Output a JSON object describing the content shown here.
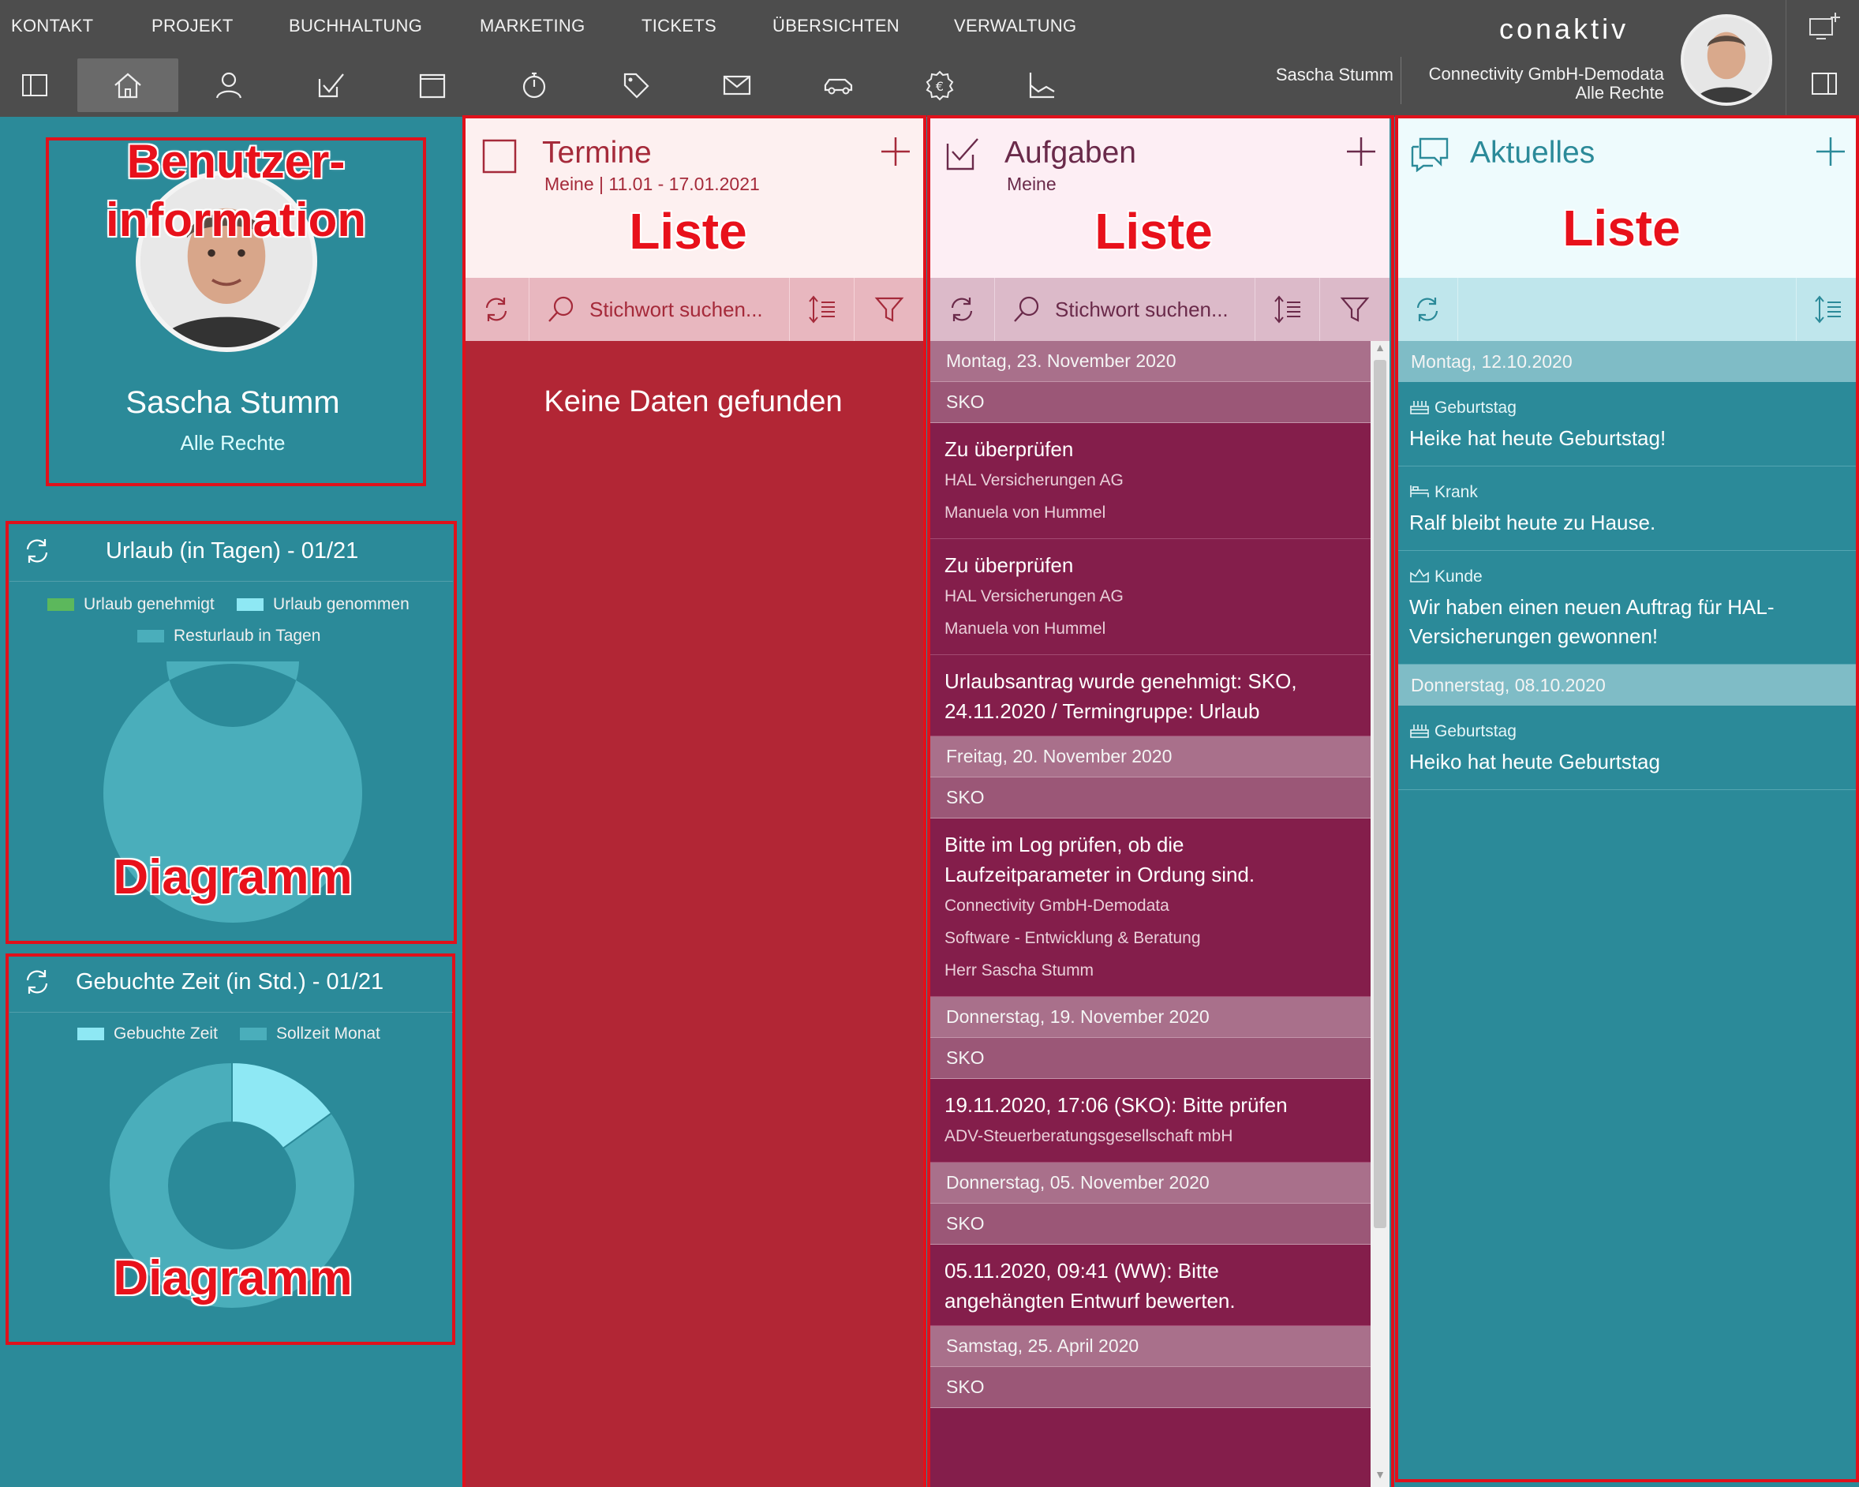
{
  "nav": {
    "menu": [
      "KONTAKT",
      "PROJEKT",
      "BUCHHALTUNG",
      "MARKETING",
      "TICKETS",
      "ÜBERSICHTEN",
      "VERWALTUNG"
    ],
    "icons": [
      "sidebar-left-icon",
      "home-icon",
      "contact-icon",
      "task-icon",
      "calendar-icon",
      "stopwatch-icon",
      "tag-icon",
      "mail-icon",
      "car-icon",
      "euro-icon",
      "chart-icon"
    ],
    "brand": "conaktiv",
    "user_name": "Sascha Stumm",
    "company": "Connectivity GmbH-Demodata",
    "rights": "Alle Rechte"
  },
  "profile": {
    "annotation": "Benutzer-information",
    "name": "Sascha Stumm",
    "role": "Alle Rechte"
  },
  "widgets": {
    "annotation": "Diagramm",
    "vacation": {
      "title": "Urlaub (in Tagen) - 01/21",
      "legend": [
        "Urlaub genehmigt",
        "Urlaub genommen",
        "Resturlaub in Tagen"
      ],
      "colors": [
        "#5cb85c",
        "#8ee8f4",
        "#4aaebb"
      ]
    },
    "time": {
      "title": "Gebuchte Zeit (in Std.) - 01/21",
      "legend": [
        "Gebuchte Zeit",
        "Sollzeit Monat"
      ],
      "colors": [
        "#8ee8f4",
        "#4aaebb"
      ]
    }
  },
  "chart_data": [
    {
      "type": "pie",
      "title": "Urlaub (in Tagen) - 01/21",
      "categories": [
        "Urlaub genehmigt",
        "Urlaub genommen",
        "Resturlaub in Tagen"
      ],
      "values": [
        0,
        0,
        1
      ]
    },
    {
      "type": "pie",
      "title": "Gebuchte Zeit (in Std.) - 01/21",
      "categories": [
        "Gebuchte Zeit",
        "Sollzeit Monat"
      ],
      "values": [
        0.15,
        0.85
      ]
    }
  ],
  "termine": {
    "title": "Termine",
    "subtitle": "Meine | 11.01 - 17.01.2021",
    "annotation": "Liste",
    "search_placeholder": "Stichwort suchen...",
    "empty": "Keine Daten gefunden"
  },
  "aufgaben": {
    "title": "Aufgaben",
    "subtitle": "Meine",
    "annotation": "Liste",
    "search_placeholder": "Stichwort suchen...",
    "rows": [
      {
        "kind": "date",
        "text": "Montag, 23. November 2020"
      },
      {
        "kind": "user",
        "text": "SKO"
      },
      {
        "kind": "item",
        "title": [
          "Zu überprüfen"
        ],
        "sub": [
          "HAL Versicherungen AG",
          "Manuela von Hummel"
        ]
      },
      {
        "kind": "item",
        "title": [
          "Zu überprüfen"
        ],
        "sub": [
          "HAL Versicherungen AG",
          "Manuela von Hummel"
        ]
      },
      {
        "kind": "item",
        "title": [
          "Urlaubsantrag wurde genehmigt: SKO,",
          "24.11.2020 / Termingruppe: Urlaub"
        ],
        "sub": []
      },
      {
        "kind": "date",
        "text": "Freitag, 20. November 2020"
      },
      {
        "kind": "user",
        "text": "SKO"
      },
      {
        "kind": "item",
        "title": [
          "Bitte im Log prüfen, ob die",
          "Laufzeitparameter in Ordung sind."
        ],
        "sub": [
          "Connectivity GmbH-Demodata",
          "Software - Entwicklung & Beratung",
          "Herr Sascha Stumm"
        ]
      },
      {
        "kind": "date",
        "text": "Donnerstag, 19. November 2020"
      },
      {
        "kind": "user",
        "text": "SKO"
      },
      {
        "kind": "item",
        "title": [
          "19.11.2020, 17:06 (SKO): Bitte prüfen"
        ],
        "sub": [
          "ADV-Steuerberatungsgesellschaft mbH"
        ]
      },
      {
        "kind": "date",
        "text": "Donnerstag, 05. November 2020"
      },
      {
        "kind": "user",
        "text": "SKO"
      },
      {
        "kind": "item",
        "title": [
          "05.11.2020, 09:41 (WW): Bitte",
          "angehängten Entwurf bewerten."
        ],
        "sub": []
      },
      {
        "kind": "date",
        "text": "Samstag, 25. April 2020"
      },
      {
        "kind": "user",
        "text": "SKO"
      }
    ]
  },
  "aktuelles": {
    "title": "Aktuelles",
    "annotation": "Liste",
    "rows": [
      {
        "kind": "date",
        "text": "Montag, 12.10.2020"
      },
      {
        "kind": "news",
        "icon": "cake-icon",
        "category": "Geburtstag",
        "text": [
          "Heike hat heute Geburtstag!"
        ]
      },
      {
        "kind": "news",
        "icon": "bed-icon",
        "category": "Krank",
        "text": [
          "Ralf bleibt heute zu Hause."
        ]
      },
      {
        "kind": "news",
        "icon": "crown-icon",
        "category": "Kunde",
        "text": [
          "Wir haben einen neuen Auftrag für HAL-",
          "Versicherungen gewonnen!"
        ]
      },
      {
        "kind": "date",
        "text": "Donnerstag, 08.10.2020"
      },
      {
        "kind": "news",
        "icon": "cake-icon",
        "category": "Geburtstag",
        "text": [
          "Heiko hat heute Geburtstag"
        ]
      }
    ]
  }
}
